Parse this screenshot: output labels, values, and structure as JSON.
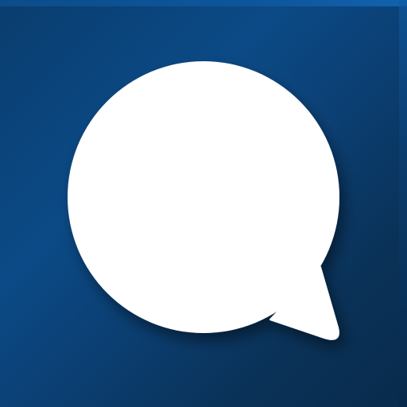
{
  "icon": {
    "name": "speech-bubble",
    "background_color": "#0b4378",
    "bubble_color": "#ffffff"
  }
}
